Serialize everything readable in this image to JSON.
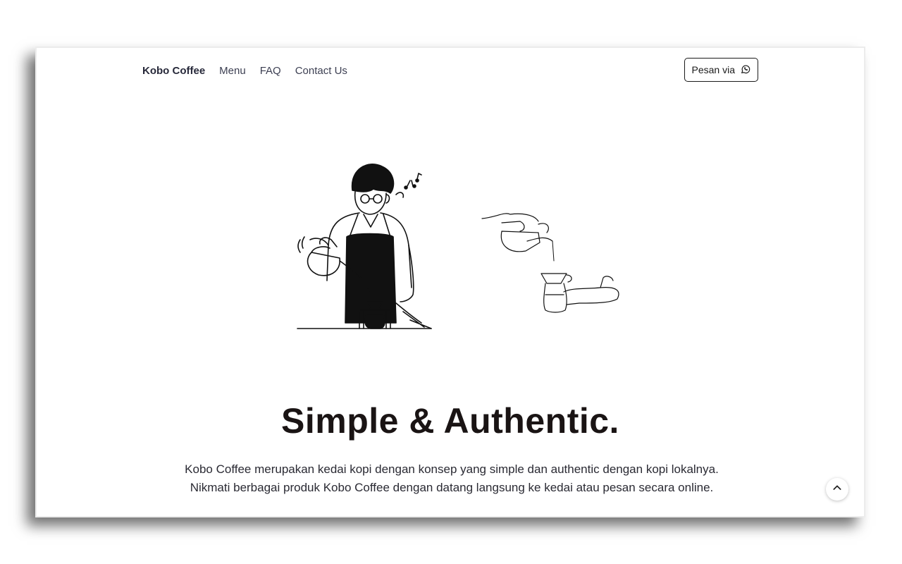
{
  "nav": {
    "brand": "Kobo Coffee",
    "links": [
      "Menu",
      "FAQ",
      "Contact Us"
    ],
    "order_button": "Pesan via",
    "order_icon": "whatsapp-icon"
  },
  "hero": {
    "title": "Simple & Authentic.",
    "description": "Kobo Coffee merupakan kedai kopi dengan konsep yang simple dan authentic dengan kopi lokalnya. Nikmati berbagai produk Kobo Coffee dengan datang langsung ke kedai atau pesan secara online."
  },
  "scroll_top_icon": "chevron-up-icon",
  "colors": {
    "text_dark": "#1a1414",
    "nav_text": "#3c3f52",
    "brand_text": "#27293a"
  }
}
